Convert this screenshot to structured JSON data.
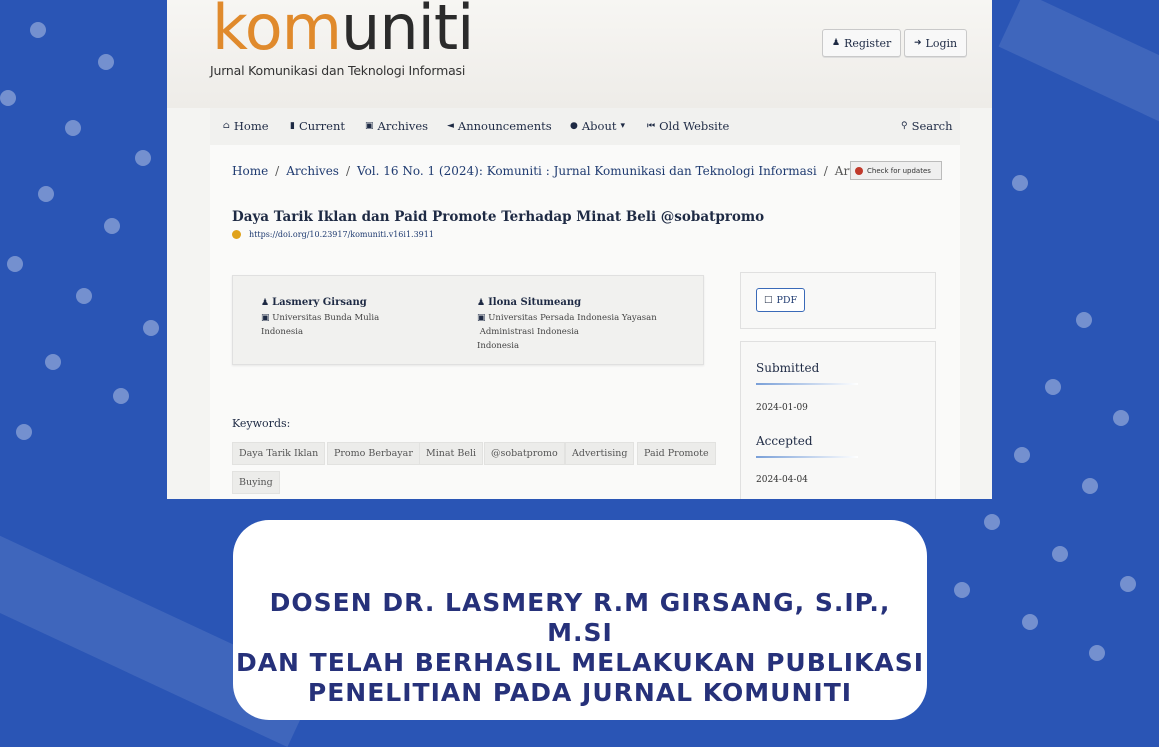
{
  "logo": {
    "part1": "kom",
    "part2": "uniti",
    "subtitle": "Jurnal Komunikasi dan Teknologi Informasi"
  },
  "user_nav": {
    "register": "Register",
    "login": "Login"
  },
  "nav": {
    "home": "Home",
    "current": "Current",
    "archives": "Archives",
    "announcements": "Announcements",
    "about": "About",
    "old_website": "Old Website",
    "search": "Search"
  },
  "breadcrumb": {
    "home": "Home",
    "archives": "Archives",
    "issue": "Vol. 16 No. 1 (2024): Komuniti : Jurnal Komunikasi dan Teknologi Informasi",
    "current": "Articles",
    "separator": "/"
  },
  "check_updates": "Check for updates",
  "article": {
    "title": "Daya Tarik Iklan dan Paid Promote Terhadap Minat Beli @sobatpromo",
    "doi": "https://doi.org/10.23917/komuniti.v16i1.3911"
  },
  "authors": [
    {
      "name": "Lasmery Girsang",
      "affiliation": "Universitas Bunda Mulia",
      "country": "Indonesia"
    },
    {
      "name": "Ilona Situmeang",
      "affiliation_line1": "Universitas Persada Indonesia Yayasan",
      "affiliation_line2": "Administrasi Indonesia",
      "country": "Indonesia"
    }
  ],
  "keywords": {
    "label": "Keywords:",
    "items": [
      "Daya Tarik Iklan",
      "Promo Berbayar",
      "Minat Beli",
      "@sobatpromo",
      "Advertising",
      "Paid Promote",
      "Buying"
    ]
  },
  "sidebar": {
    "pdf_label": "PDF",
    "submitted_label": "Submitted",
    "submitted_date": "2024-01-09",
    "accepted_label": "Accepted",
    "accepted_date": "2024-04-04"
  },
  "caption": {
    "line1": "Dosen Dr. Lasmery R.M Girsang, S.IP., M.Si",
    "line2": "dan telah berhasil melakukan publikasi",
    "line3": "penelitian pada Jurnal Komuniti"
  },
  "colors": {
    "background": "#2a55b5",
    "accent_orange": "#e08a2c",
    "navy_text": "#26317a"
  }
}
